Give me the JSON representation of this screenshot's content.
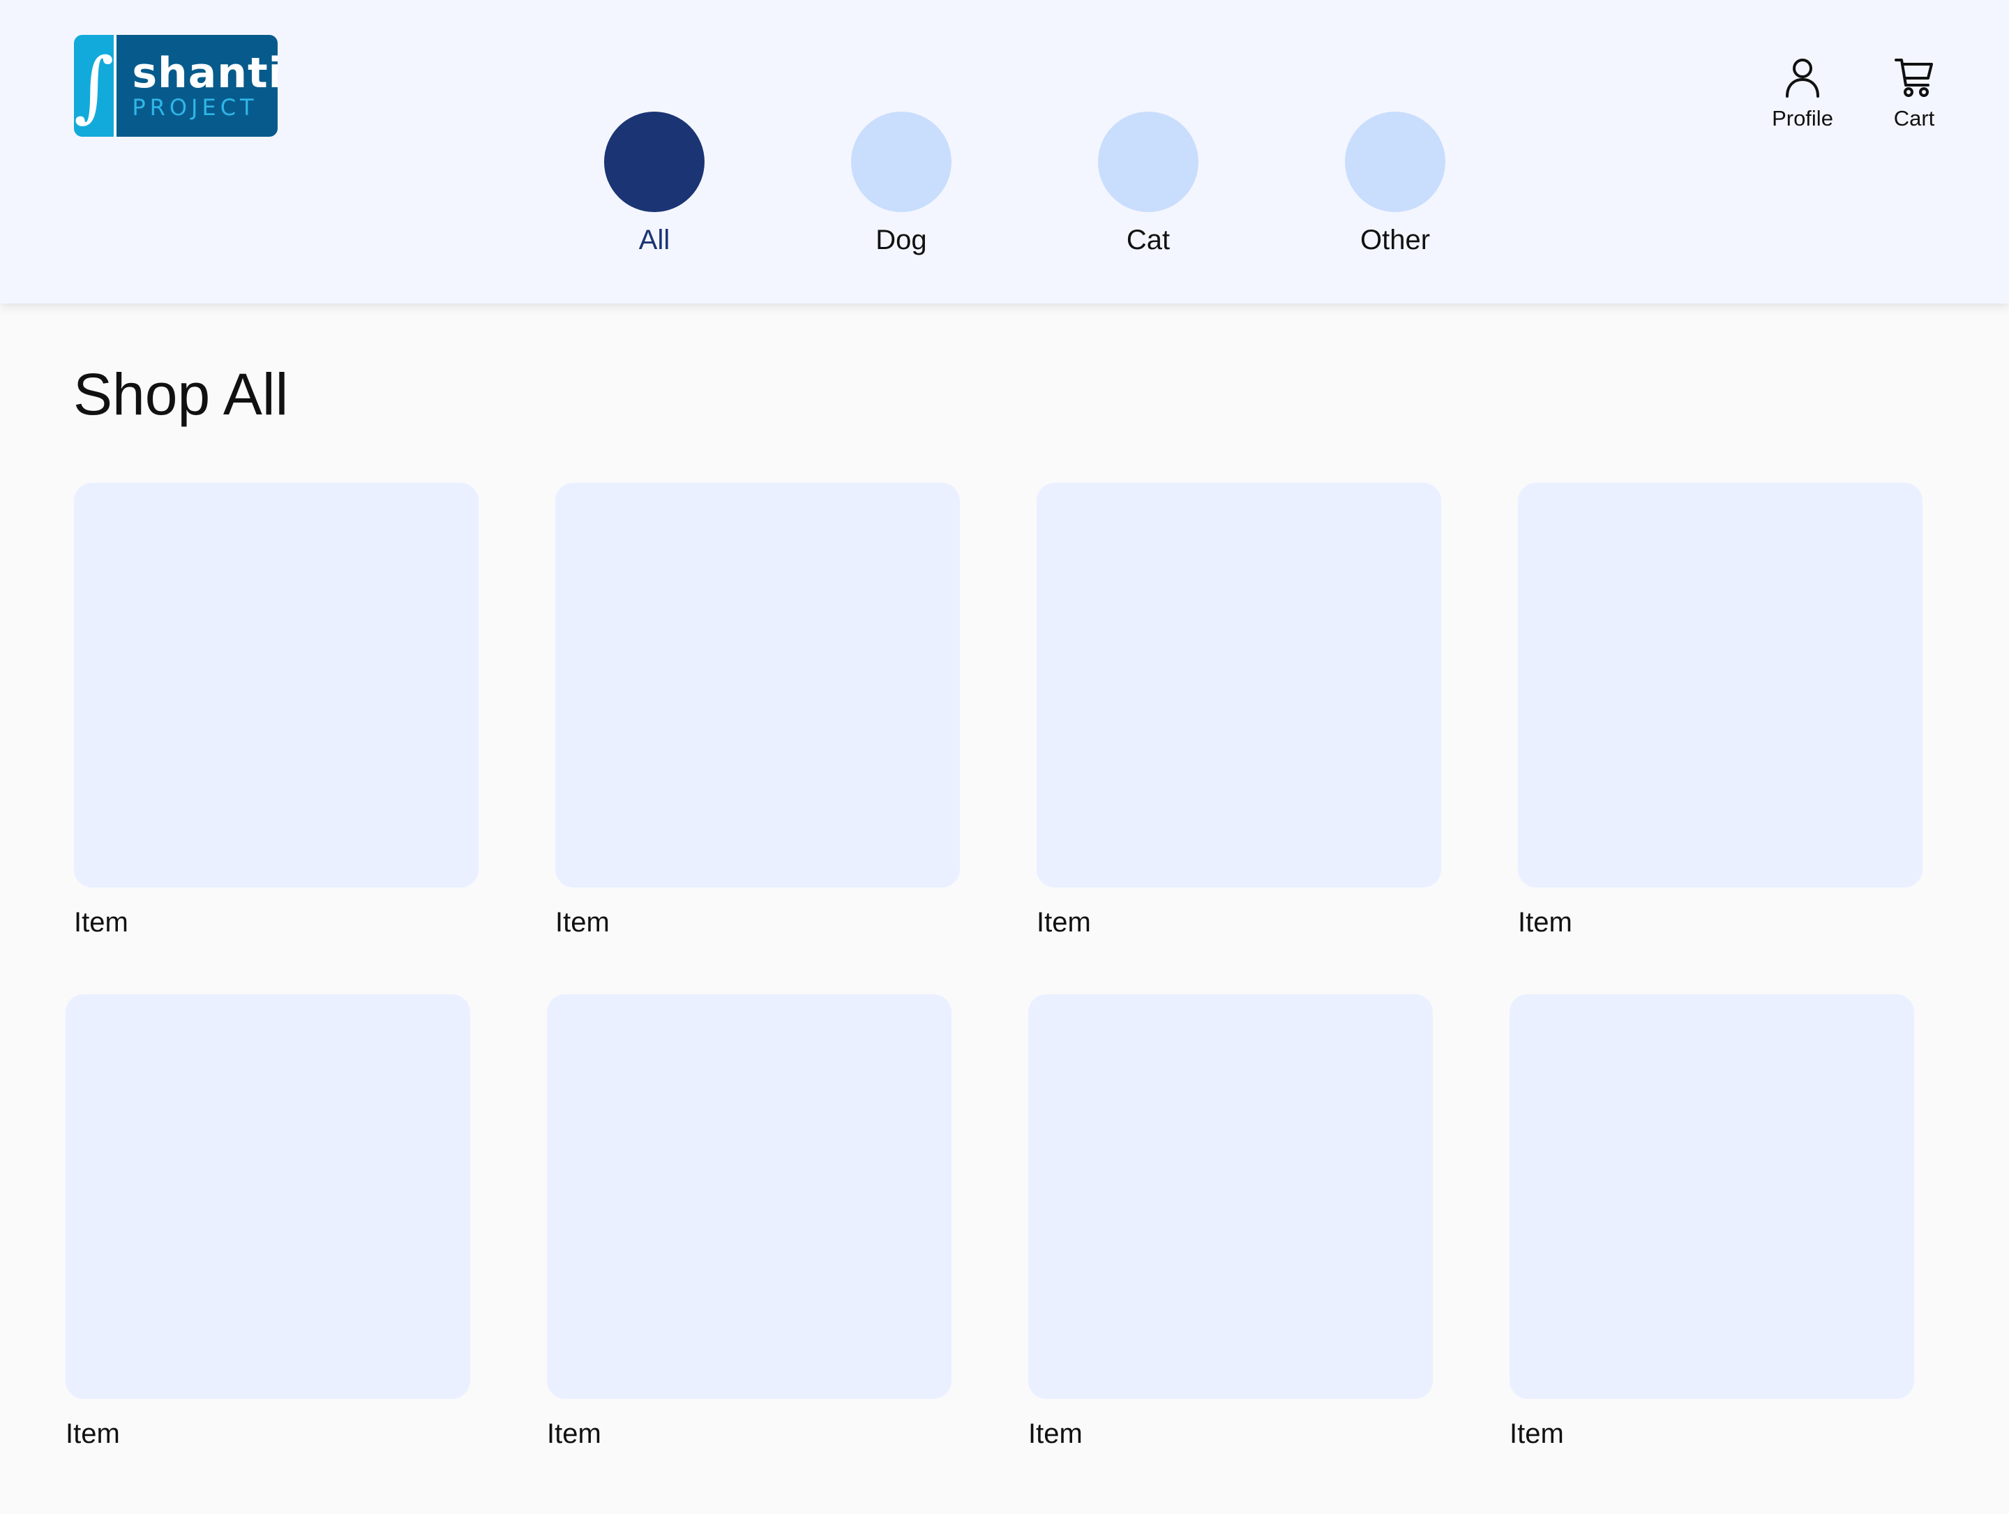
{
  "brand": {
    "logo_word": "shanti",
    "logo_sub": "PROJECT"
  },
  "categories": [
    {
      "label": "All",
      "active": true
    },
    {
      "label": "Dog",
      "active": false
    },
    {
      "label": "Cat",
      "active": false
    },
    {
      "label": "Other",
      "active": false
    }
  ],
  "header_actions": {
    "profile_label": "Profile",
    "cart_label": "Cart"
  },
  "page": {
    "title": "Shop All"
  },
  "products": [
    {
      "label": "Item"
    },
    {
      "label": "Item"
    },
    {
      "label": "Item"
    },
    {
      "label": "Item"
    },
    {
      "label": "Item"
    },
    {
      "label": "Item"
    },
    {
      "label": "Item"
    },
    {
      "label": "Item"
    }
  ],
  "colors": {
    "header_bg": "#f3f6ff",
    "active_category": "#1b3474",
    "inactive_category": "#c9ddfd",
    "tile_bg": "#eaf0ff",
    "logo_dark": "#075b8c",
    "logo_light": "#12aadb"
  },
  "icons": {
    "profile": "person-icon",
    "cart": "cart-icon"
  }
}
